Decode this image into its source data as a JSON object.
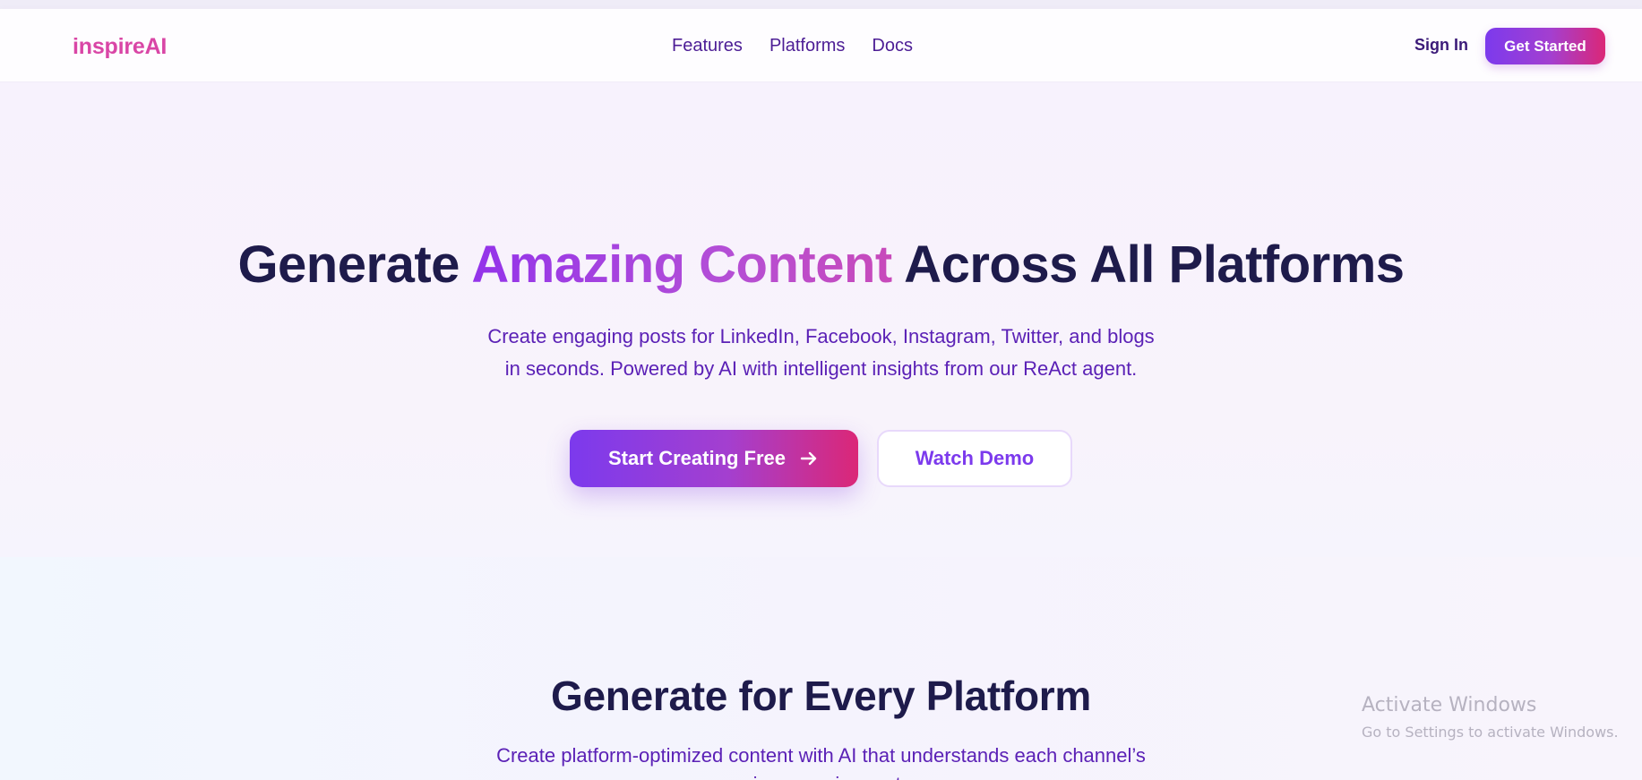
{
  "navbar": {
    "logo": "inspireAI",
    "links": [
      "Features",
      "Platforms",
      "Docs"
    ],
    "sign_in": "Sign In",
    "get_started": "Get Started"
  },
  "hero": {
    "title_part1": "Generate ",
    "title_highlight": "Amazing Content",
    "title_part2": " Across All Platforms",
    "subtitle_line1": "Create engaging posts for LinkedIn, Facebook, Instagram, Twitter, and blogs",
    "subtitle_line2": "in seconds. Powered by AI with intelligent insights from our ReAct agent.",
    "primary_cta": "Start Creating Free",
    "secondary_cta": "Watch Demo"
  },
  "platforms_section": {
    "title": "Generate for Every Platform",
    "subtitle_line1": "Create platform-optimized content with AI that understands each channel’s",
    "subtitle_line2": "unique requirements"
  },
  "watermark": {
    "line1": "Activate Windows",
    "line2": "Go to Settings to activate Windows."
  },
  "colors": {
    "brand_pink": "#d946a6",
    "brand_purple": "#7c3aed",
    "brand_magenta": "#db2777",
    "heading_navy": "#1e1b4b",
    "text_purple": "#5b21b6"
  }
}
